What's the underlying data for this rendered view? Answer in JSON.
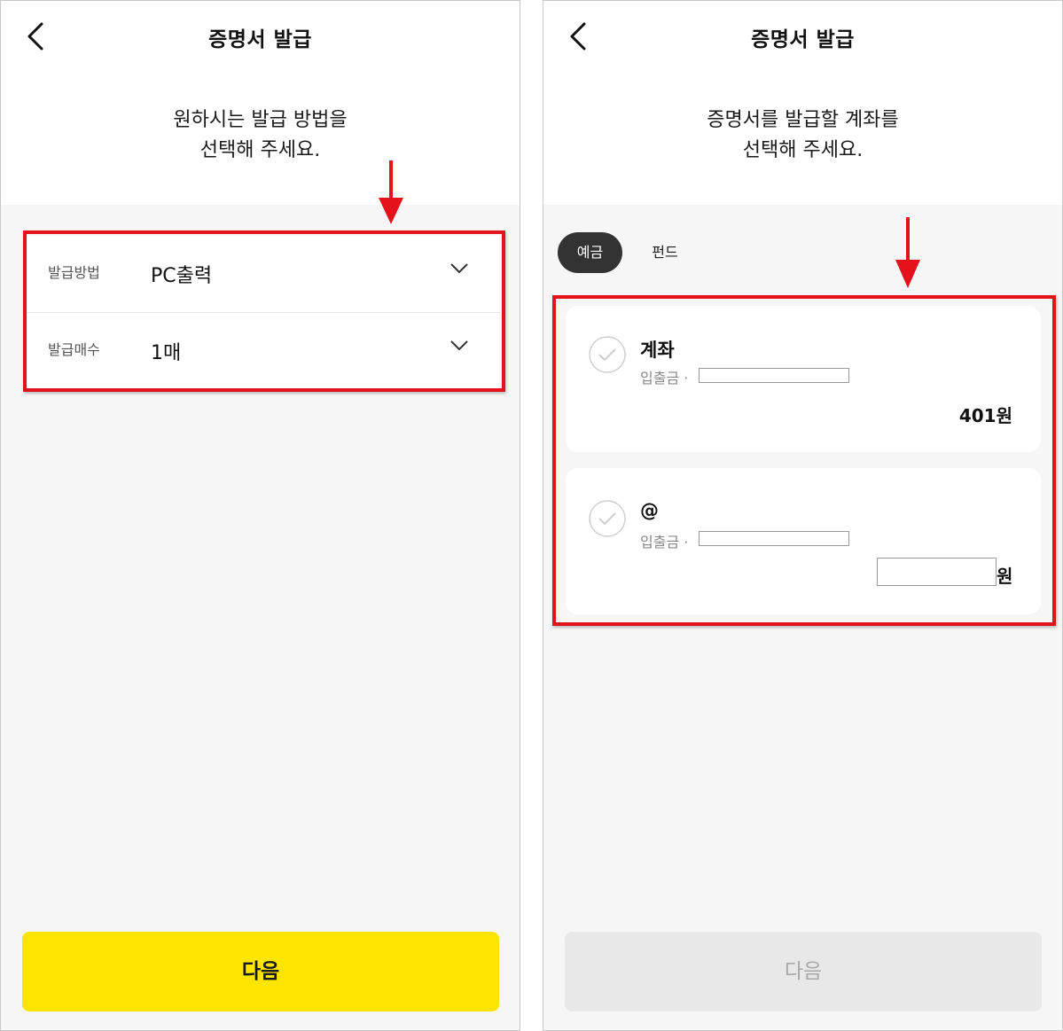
{
  "left_screen": {
    "title": "증명서 발급",
    "intro_line1": "원하시는 발급 방법을",
    "intro_line2": "선택해 주세요.",
    "rows": [
      {
        "label": "발급방법",
        "value": "PC출력"
      },
      {
        "label": "발급매수",
        "value": "1매"
      }
    ],
    "next_label": "다음"
  },
  "right_screen": {
    "title": "증명서 발급",
    "intro_line1": "증명서를 발급할 계좌를",
    "intro_line2": "선택해 주세요.",
    "tabs": [
      {
        "label": "예금",
        "active": true
      },
      {
        "label": "펀드",
        "active": false
      }
    ],
    "accounts": [
      {
        "name": "계좌",
        "type": "입출금 ·",
        "amount": "401원"
      },
      {
        "name": "@",
        "type": "입출금 ·",
        "unit": "원"
      }
    ],
    "next_label": "다음",
    "next_enabled": false
  },
  "icons": {
    "back": "back-arrow-icon",
    "dropdown": "chevron-down-icon",
    "check": "check-circle-icon",
    "annotation": "red-arrow-icon"
  },
  "colors": {
    "accent_yellow": "#fee500",
    "annotation_red": "#e3121b",
    "tab_active": "#333333",
    "disabled_button": "#e8e8e8"
  }
}
